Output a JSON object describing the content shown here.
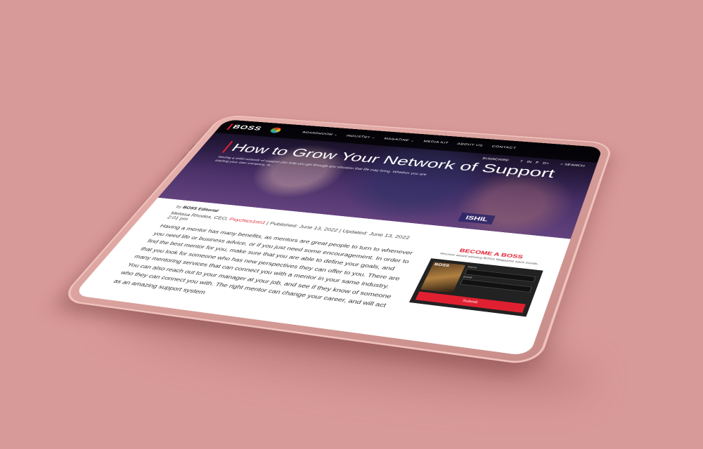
{
  "site": {
    "logo": "BOSS",
    "nav": [
      "BOARDROOM ⌄",
      "INDUSTRY ⌄",
      "MAGAZINE ⌄",
      "MEDIA KIT",
      "ABOUT US",
      "CONTACT"
    ],
    "subscribe": "SUBSCRIBE",
    "social": [
      "twitter-icon",
      "linkedin-icon",
      "facebook-icon",
      "google-plus-icon"
    ],
    "search": "SEARCH"
  },
  "hero": {
    "title": "How to Grow Your Network of Support",
    "subtitle": "Having a solid network of support can help you get through any situation that life may bring. Whether you are starting your own company, or...",
    "sign": "ISHIL"
  },
  "article": {
    "by_prefix": "by",
    "author": "BOSS Editorial",
    "meta_author": "Melissa Rhodes, CEO,",
    "meta_link": "Psychics1on1",
    "published": "Published: June 13, 2022",
    "updated": "Updated: June 13, 2022 2:01 pm",
    "body": "Having a mentor has many benefits, as mentors are great people to turn to whenever you need life or business advice, or if you just need some encouragement. In order to find the best mentor for you, make sure that you are able to define your goals, and that you look for someone who has new perspectives they can offer to you. There are many mentoring services that can connect you with a mentor in your same industry. You can also reach out to your manager at your job, and see if they know of someone who they can connect you with. The right mentor can change your career, and will act as an amazing support system"
  },
  "sidebar": {
    "title": "BECOME A BOSS",
    "description": "Receive award winning BOSS Magazine each month.",
    "magazine": "BOSS",
    "name_label": "Name",
    "email_label": "Email",
    "submit": "Submit"
  },
  "colors": {
    "accent": "#e02030",
    "background": "#d89a98",
    "tablet": "#e9b4af"
  }
}
